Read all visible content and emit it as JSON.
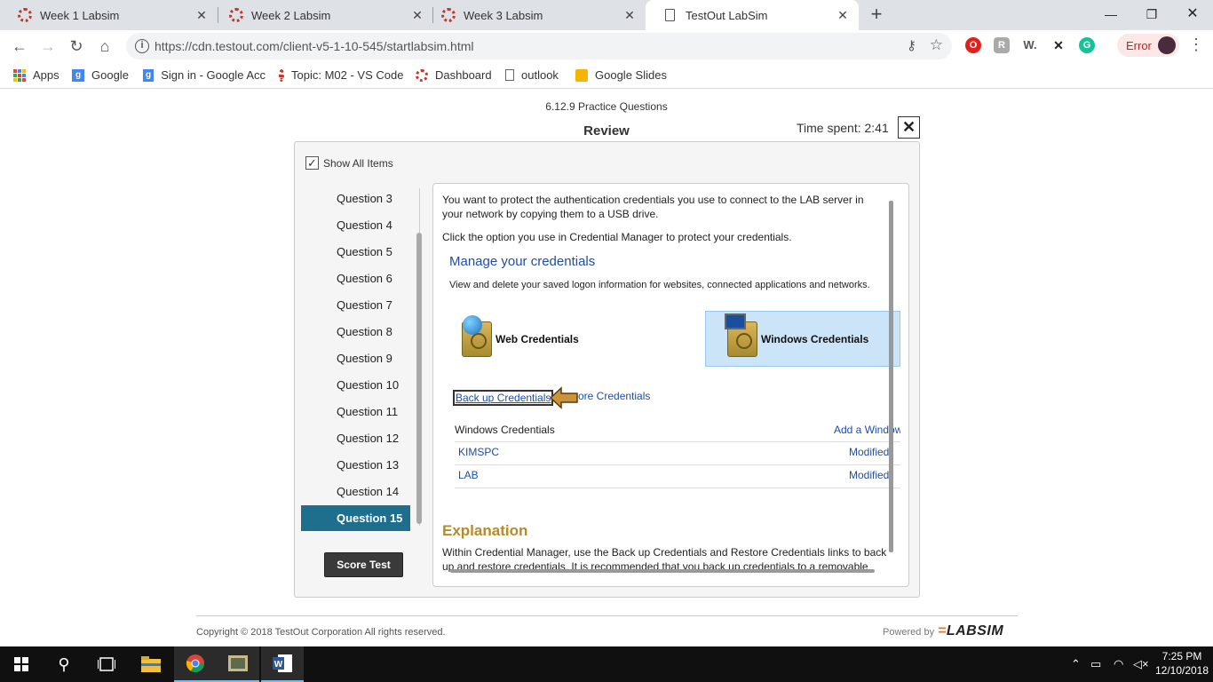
{
  "browser": {
    "tabs": [
      {
        "title": "Week 1 Labsim",
        "active": false
      },
      {
        "title": "Week 2 Labsim",
        "active": false
      },
      {
        "title": "Week 3 Labsim",
        "active": false
      },
      {
        "title": "TestOut LabSim",
        "active": true
      }
    ],
    "url": "https://cdn.testout.com/client-v5-1-10-545/startlabsim.html",
    "error_label": "Error",
    "bookmarks": [
      "Apps",
      "Google",
      "Sign in - Google Acc",
      "Topic: M02 - VS Code",
      "Dashboard",
      "outlook",
      "Google Slides"
    ]
  },
  "page": {
    "subtitle": "6.12.9 Practice Questions",
    "title": "Review",
    "time_spent": "Time spent: 2:41",
    "close_glyph": "✕",
    "show_all_label": "Show All Items",
    "show_all_checked": true,
    "questions": [
      "Question 3",
      "Question 4",
      "Question 5",
      "Question 6",
      "Question 7",
      "Question 8",
      "Question 9",
      "Question 10",
      "Question 11",
      "Question 12",
      "Question 13",
      "Question 14",
      "Question 15"
    ],
    "active_question": "Question 15",
    "score_button": "Score Test"
  },
  "question": {
    "prompt_1": "You want to protect the authentication credentials you use to connect to the LAB server in your network by copying them to a USB drive.",
    "prompt_2": "Click the option you use in Credential Manager to protect your credentials.",
    "cm_title": "Manage your credentials",
    "cm_desc": "View and delete your saved logon information for websites, connected applications and networks.",
    "web_credentials": "Web Credentials",
    "windows_credentials": "Windows Credentials",
    "backup_link": "Back up Credentials",
    "restore_link": "Restore Credentials",
    "restore_link_visible": "ore Credentials",
    "wc_header": "Windows Credentials",
    "add_link": "Add a Windows credential",
    "entries": [
      {
        "name": "KIMSPC",
        "status": "Modified"
      },
      {
        "name": "LAB",
        "status": "Modified"
      }
    ],
    "explanation_title": "Explanation",
    "explanation_text": "Within Credential Manager, use the Back up Credentials and Restore Credentials links to back up and restore credentials. It is recommended that you back up credentials to a removable device such as a USB flash drive to protect them from a hard disk crash."
  },
  "footer": {
    "copyright": "Copyright © 2018  TestOut Corporation All rights reserved.",
    "powered_by": "Powered by",
    "logo": "LABSIM"
  },
  "taskbar": {
    "time": "7:25 PM",
    "date": "12/10/2018"
  },
  "colors": {
    "accent": "#1e6e8e",
    "link": "#1f4ea3",
    "explanation": "#b58a2a",
    "selected_tile": "#cce4f7"
  }
}
